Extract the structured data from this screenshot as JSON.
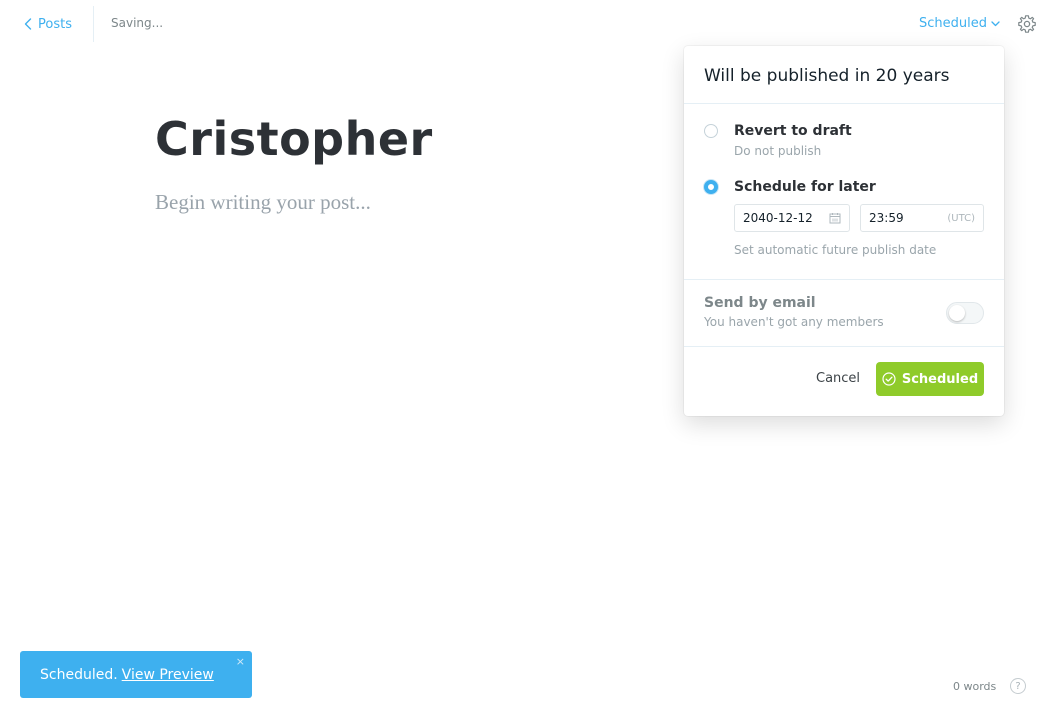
{
  "nav": {
    "back_label": "Posts",
    "saving_status": "Saving...",
    "status_label": "Scheduled"
  },
  "editor": {
    "title": "Cristopher",
    "body_placeholder": "Begin writing your post..."
  },
  "publish_menu": {
    "header": "Will be published in 20 years",
    "options": [
      {
        "label": "Revert to draft",
        "description": "Do not publish",
        "selected": false
      },
      {
        "label": "Schedule for later",
        "description": "Set automatic future publish date",
        "selected": true
      }
    ],
    "date_value": "2040-12-12",
    "time_value": "23:59",
    "timezone": "(UTC)",
    "email": {
      "label": "Send by email",
      "description": "You haven't got any members",
      "enabled": false
    },
    "cancel_label": "Cancel",
    "confirm_label": "Scheduled"
  },
  "notification": {
    "message": "Scheduled.",
    "link_label": "View Preview",
    "close_glyph": "×"
  },
  "footer": {
    "word_count": "0 words",
    "help_glyph": "?"
  },
  "colors": {
    "accent": "#3eb0ef",
    "success": "#8fcb2a",
    "title_text": "#2d3136"
  },
  "icons": [
    "chevron-left-icon",
    "chevron-down-icon",
    "gear-icon",
    "calendar-icon",
    "check-circle-icon",
    "close-icon",
    "help-icon"
  ]
}
